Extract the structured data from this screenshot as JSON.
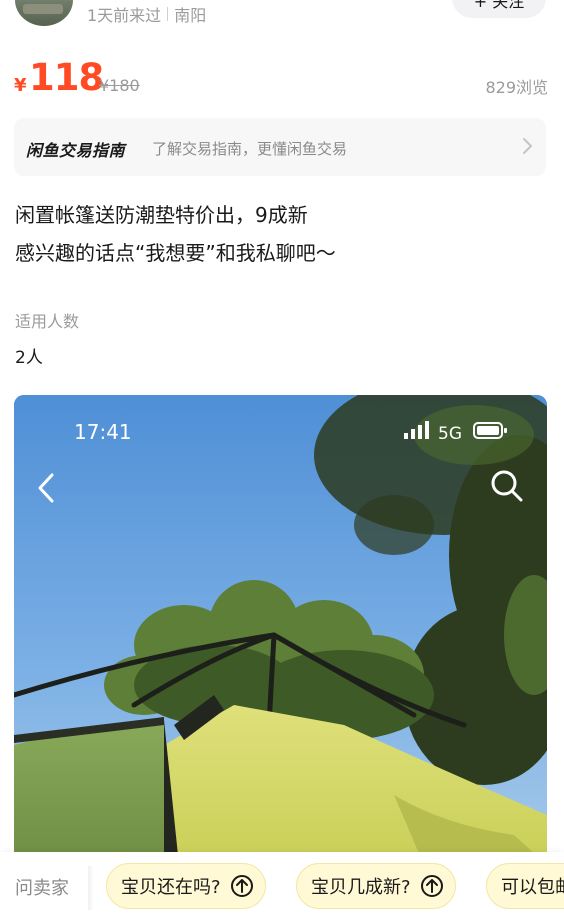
{
  "seller": {
    "last_seen": "1天前来过",
    "location": "南阳",
    "follow_label": "+ 关注"
  },
  "price": {
    "currency": "¥",
    "current": "118",
    "original": "¥180",
    "views": "829浏览"
  },
  "guide": {
    "title": "闲鱼交易指南",
    "subtitle": "了解交易指南，更懂闲鱼交易"
  },
  "description": {
    "line1": "闲置帐篷送防潮垫特价出，9成新",
    "line2": "感兴趣的话点“我想要”和我私聊吧～"
  },
  "spec": {
    "label": "适用人数",
    "value": "2人"
  },
  "photo": {
    "status_time": "17:41",
    "network": "5G"
  },
  "bottom": {
    "ask_label": "问卖家",
    "quick_questions": [
      "宝贝还在吗?",
      "宝贝几成新?",
      "可以包邮吗?"
    ]
  }
}
